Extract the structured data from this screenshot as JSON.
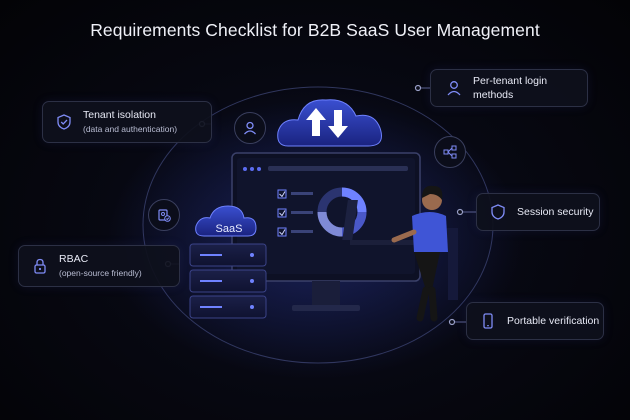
{
  "title": "Requirements Checklist for B2B SaaS User Management",
  "cards": {
    "tenant_isolation": {
      "label": "Tenant isolation",
      "sub": "(data and authentication)",
      "icon": "shield-icon"
    },
    "rbac": {
      "label": "RBAC",
      "sub": "(open-source friendly)",
      "icon": "lock-icon"
    },
    "login_methods": {
      "label": "Per-tenant login methods",
      "icon": "user-icon"
    },
    "session_security": {
      "label": "Session security",
      "icon": "shield-icon"
    },
    "portable_verification": {
      "label": "Portable verification",
      "icon": "phone-icon"
    }
  },
  "server_label": "SaaS",
  "colors": {
    "accent": "#5b6cf0",
    "card_border": "#2c3045",
    "orbit": "#3b4270"
  }
}
